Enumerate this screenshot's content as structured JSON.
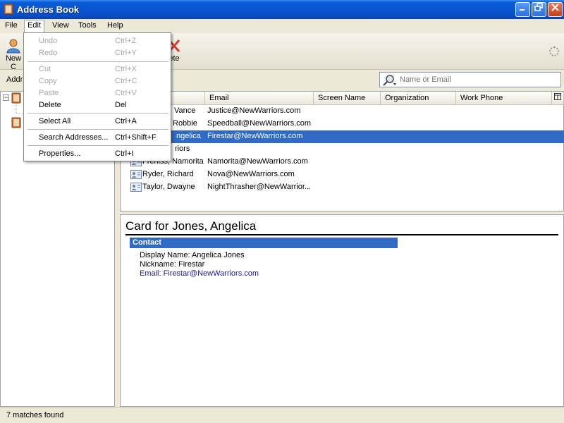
{
  "window": {
    "title": "Address Book",
    "title_color": "#0a54d0"
  },
  "menubar": {
    "items": [
      {
        "label": "File"
      },
      {
        "label": "Edit"
      },
      {
        "label": "View"
      },
      {
        "label": "Tools"
      },
      {
        "label": "Help"
      }
    ]
  },
  "edit_menu": {
    "items": [
      {
        "label": "Undo",
        "shortcut": "Ctrl+Z",
        "enabled": false
      },
      {
        "label": "Redo",
        "shortcut": "Ctrl+Y",
        "enabled": false
      },
      {
        "label": "Cut",
        "shortcut": "Ctrl+X",
        "enabled": false
      },
      {
        "label": "Copy",
        "shortcut": "Ctrl+C",
        "enabled": false
      },
      {
        "label": "Paste",
        "shortcut": "Ctrl+V",
        "enabled": false
      },
      {
        "label": "Delete",
        "shortcut": "Del",
        "enabled": true
      },
      {
        "label": "Select All",
        "shortcut": "Ctrl+A",
        "enabled": true
      },
      {
        "label": "Search Addresses...",
        "shortcut": "Ctrl+Shift+F",
        "enabled": true
      },
      {
        "label": "Properties...",
        "shortcut": "Ctrl+I",
        "enabled": true
      }
    ]
  },
  "toolbar": {
    "new_label_partial": "New C",
    "delete_label_partial": "ete"
  },
  "subbar": {
    "label_partial": "Addr"
  },
  "search": {
    "placeholder": "Name or Email"
  },
  "results": {
    "columns": [
      "Email",
      "Screen Name",
      "Organization",
      "Work Phone"
    ],
    "rows": [
      {
        "name": "Vance",
        "email": "Justice@NewWarriors.com",
        "selected": false
      },
      {
        "name": "Robbie",
        "email": "Speedball@NewWarriors.com",
        "selected": false
      },
      {
        "name": "ngelica",
        "email": "Firestar@NewWarriors.com",
        "selected": true
      },
      {
        "name": "riors",
        "email": "",
        "selected": false
      },
      {
        "name": "Frenlss, Namorita",
        "email": "Namorita@NewWarriors.com",
        "selected": false
      },
      {
        "name": "Ryder, Richard",
        "email": "Nova@NewWarriors.com",
        "selected": false
      },
      {
        "name": "Taylor, Dwayne",
        "email": "NightThrasher@NewWarrior...",
        "selected": false
      }
    ]
  },
  "card": {
    "title": "Card for Jones, Angelica",
    "section": "Contact",
    "display_name": "Display Name: Angelica Jones",
    "nickname": "Nickname: Firestar",
    "email": "Email: Firestar@NewWarriors.com",
    "email_color": "#1a1aa6"
  },
  "status": {
    "text": "7 matches found"
  }
}
